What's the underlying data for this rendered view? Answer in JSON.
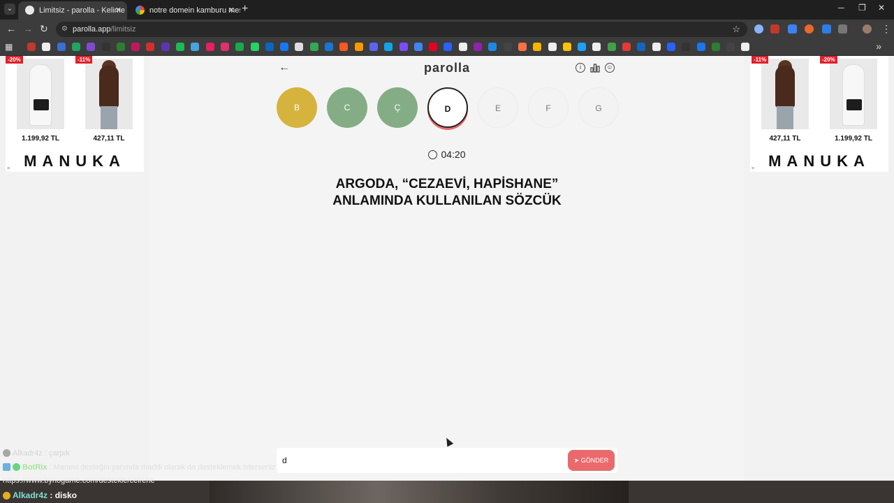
{
  "browser": {
    "tabs": [
      {
        "title": "Limitsiz - parolla - Kelime oyunu",
        "active": true
      },
      {
        "title": "notre domein kamburu meslek",
        "active": false
      }
    ],
    "url_host": "parolla.app",
    "url_path": "/limitsiz"
  },
  "ads": {
    "brand": "MANUKA",
    "left": [
      {
        "badge": "-20%",
        "price": "1.199,92 TL",
        "look": "white"
      },
      {
        "badge": "-11%",
        "price": "427,11 TL",
        "look": "brown"
      }
    ],
    "right": [
      {
        "badge": "-11%",
        "price": "427,11 TL",
        "look": "brown"
      },
      {
        "badge": "-20%",
        "price": "1.199,92 TL",
        "look": "white"
      }
    ]
  },
  "game": {
    "logo": "parolla",
    "letters": [
      {
        "letter": "B",
        "state": "yellow"
      },
      {
        "letter": "C",
        "state": "green"
      },
      {
        "letter": "Ç",
        "state": "green"
      },
      {
        "letter": "D",
        "state": "current"
      },
      {
        "letter": "E",
        "state": "pending"
      },
      {
        "letter": "F",
        "state": "pending"
      },
      {
        "letter": "G",
        "state": "pending"
      }
    ],
    "timer": "04:20",
    "question_line1": "ARGODA, “CEZAEVİ, HAPİSHANE”",
    "question_line2": "ANLAMINDA KULLANILAN SÖZCÜK",
    "answer_value": "d",
    "send_label": "GÖNDER"
  },
  "chat": {
    "faded": {
      "user": "Alkadr4z",
      "text": " : çarpık"
    },
    "bot": {
      "user": "BotRix",
      "text": " : Manevi desteğin yanında maddi olarak da desteklemek isterseniz:"
    },
    "link": "https://www.bynogame.com/destekle/ceirene",
    "live": {
      "user": "Alkadr4z",
      "text": " : disko"
    }
  },
  "colors": {
    "yellow": "#d6b33c",
    "green": "#84ad86",
    "send": "#ea6a6c",
    "progress_ring": "#e86a6a"
  }
}
